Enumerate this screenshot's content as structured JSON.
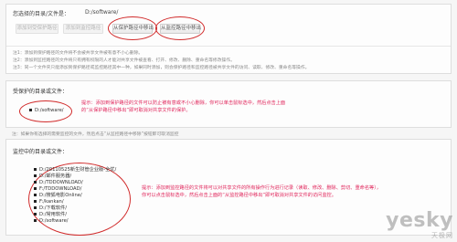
{
  "top": {
    "selected_label": "您选择的目录/文件是：",
    "selected_value": "D:/software/",
    "buttons": [
      {
        "label": "添加到受保护路径",
        "state": "disabled"
      },
      {
        "label": "添加到监控路径",
        "state": "disabled"
      },
      {
        "label": "从保护路径中移出",
        "state": "enabled"
      },
      {
        "label": "从监控路径中移出",
        "state": "enabled"
      }
    ],
    "notes": [
      "注1：添加到保护路径的文件将不会被共享文件被有意不小心删除。",
      "注2：添加到监控路径的文件将只有拥有权限的人才能对共享文件被查看、打开、修改、删除、重命名等修改操作。",
      "注3：同一个文件夹只能添加到保护路径或监控路径其中一种，如果同时添加，则会保护路径和监控路径被共享文件的访问、读取、修改、重命名等操作。"
    ]
  },
  "protected": {
    "title": "受保护的目录或文件：",
    "hint": "提示：添加到保护路径的文件可以防止被有意或不小心删除，你可以单击鼠标选中，然后点击上面的“从保护路径中移出”即可取消对共享文件的保护。",
    "items": [
      "D:/software/"
    ]
  },
  "monitor_note": "注：如果你有选择的需要监控的文件，然后点击“从监控路径中移除”按钮即可取消监控",
  "monitor": {
    "title": "监控中的目录或文件：",
    "hint": "提示：添加到监控路径的文件将可以对共享文件的所有操作行为进行记录（读取、修改、删除、剪切、重命名等），你可以点击鼠标选中，然后点击上面的“从监控路径中移出”即可取消对共享文件的访问监控。",
    "items": [
      "D:/20110525新生财管企业版-全优/",
      "D:/邮件服务器/",
      "D:/TDDOWNLOAD/",
      "F:/TDDOWNLOAD/",
      "D:/搜狐电影Online/",
      "F:/kankan/",
      "D:/下载软件/",
      "D:/常用软件/",
      "D:/software/"
    ]
  },
  "watermark": {
    "main": "yesky",
    "sub": "天极网"
  },
  "colors": {
    "highlight_circle": "#d12b2b",
    "hint_text": "#e0245a"
  }
}
